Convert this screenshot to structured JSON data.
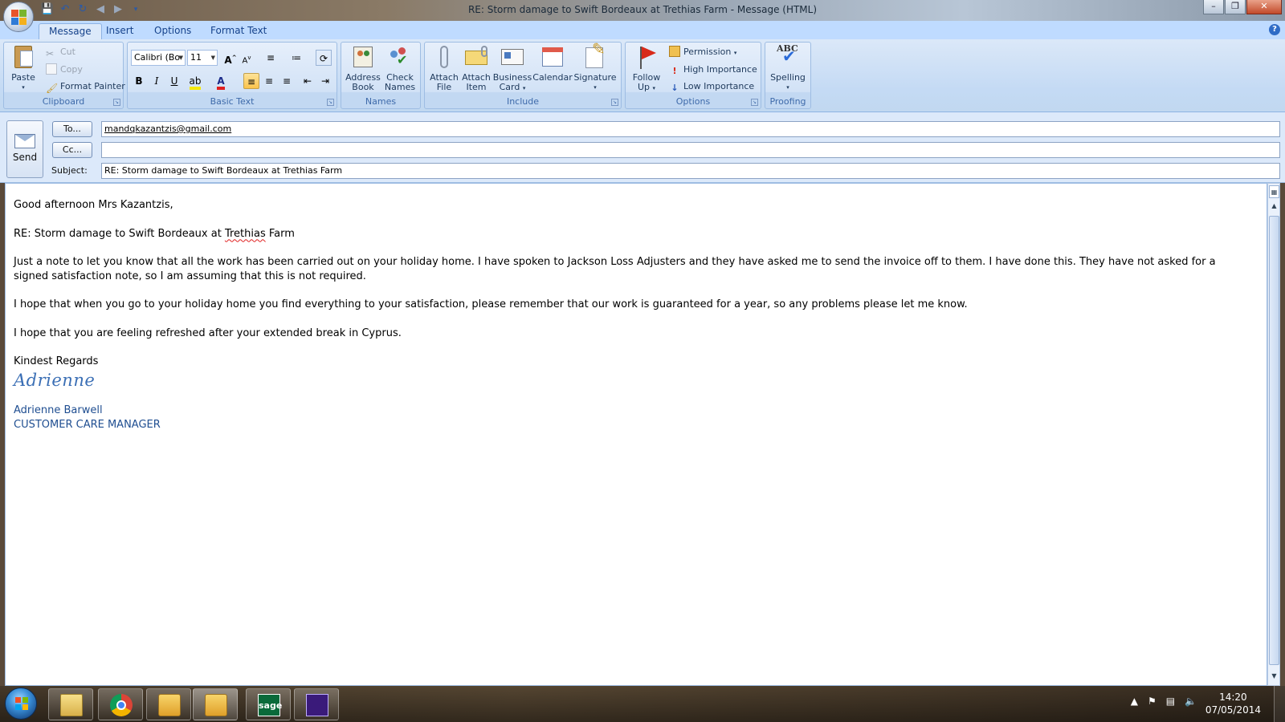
{
  "window": {
    "title": "RE: Storm damage to Swift Bordeaux at Trethias Farm - Message (HTML)"
  },
  "ribbon": {
    "tabs": [
      {
        "label": "Message",
        "active": true
      },
      {
        "label": "Insert",
        "active": false
      },
      {
        "label": "Options",
        "active": false
      },
      {
        "label": "Format Text",
        "active": false
      }
    ],
    "clipboard": {
      "label": "Clipboard",
      "paste": "Paste",
      "cut": "Cut",
      "copy": "Copy",
      "format_painter": "Format Painter"
    },
    "basic_text": {
      "label": "Basic Text",
      "font": "Calibri (Bo",
      "size": "11",
      "bold": "B",
      "italic": "I",
      "underline": "U"
    },
    "names": {
      "label": "Names",
      "address_book_1": "Address",
      "address_book_2": "Book",
      "check_names_1": "Check",
      "check_names_2": "Names"
    },
    "include": {
      "label": "Include",
      "attach_file_1": "Attach",
      "attach_file_2": "File",
      "attach_item_1": "Attach",
      "attach_item_2": "Item",
      "business_card_1": "Business",
      "business_card_2": "Card",
      "calendar": "Calendar",
      "signature": "Signature"
    },
    "options": {
      "label": "Options",
      "follow_up_1": "Follow",
      "follow_up_2": "Up",
      "permission": "Permission",
      "high_importance": "High Importance",
      "low_importance": "Low Importance"
    },
    "proofing": {
      "label": "Proofing",
      "spelling": "Spelling",
      "abc": "ABC"
    }
  },
  "header": {
    "send": "Send",
    "to_button": "To...",
    "cc_button": "Cc...",
    "subject_label": "Subject:",
    "to_value": "mandqkazantzis@gmail.com",
    "cc_value": "",
    "subject_value": "RE: Storm damage to Swift Bordeaux at Trethias Farm"
  },
  "message": {
    "greeting": "Good afternoon Mrs Kazantzis,",
    "re_prefix": "RE: Storm damage to Swift Bordeaux at ",
    "re_misspelled": "Trethias",
    "re_suffix": " Farm",
    "para1": "Just a note to let you know that all the work has been carried out on your holiday home.  I have spoken to Jackson Loss Adjusters and they have asked me to send the invoice off to them.  I have done this.  They have not asked for a signed satisfaction note, so I am assuming that this is not required.",
    "para2": "I hope that when you go to your holiday home you find everything to your satisfaction, please  remember that our work is guaranteed for a year, so any problems please let me know.",
    "para3": "I hope that you are feeling refreshed after your extended break in Cyprus.",
    "closing": "Kindest Regards",
    "signature_script": "Adrienne",
    "sig_name": "Adrienne Barwell",
    "sig_title": "CUSTOMER CARE MANAGER"
  },
  "taskbar": {
    "time": "14:20",
    "date": "07/05/2014",
    "sage": "sage"
  },
  "colors": {
    "accent": "#15428b",
    "ribbon_bg": "#c4daf4",
    "signature": "#3b6fb5"
  }
}
